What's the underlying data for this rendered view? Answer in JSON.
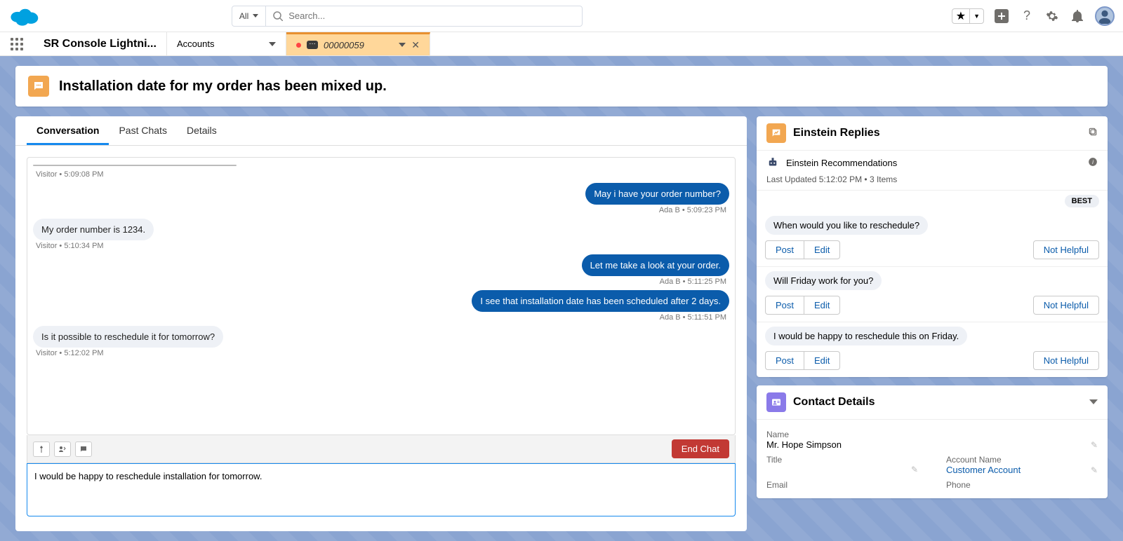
{
  "topbar": {
    "search_scope": "All",
    "search_placeholder": "Search..."
  },
  "nav": {
    "app_name": "SR Console Lightni...",
    "tab_accounts": "Accounts",
    "tab_record_number": "00000059"
  },
  "header": {
    "title": "Installation date for my order has been mixed up."
  },
  "tabs": {
    "conversation": "Conversation",
    "past_chats": "Past Chats",
    "details": "Details"
  },
  "chat": {
    "m0_meta": "Visitor • 5:09:08 PM",
    "m1_text": "May i have your order number?",
    "m1_meta": "Ada B • 5:09:23 PM",
    "m2_text": "My order number is 1234.",
    "m2_meta": "Visitor • 5:10:34 PM",
    "m3_text": "Let me take a look at your order.",
    "m3_meta": "Ada B • 5:11:25 PM",
    "m4_text": "I see that installation date has been scheduled after 2 days.",
    "m4_meta": "Ada B • 5:11:51 PM",
    "m5_text": "Is it possible to reschedule it for tomorrow?",
    "m5_meta": "Visitor • 5:12:02 PM"
  },
  "compose": {
    "end_chat": "End Chat",
    "draft": "I would be happy to reschedule installation for tomorrow."
  },
  "einstein": {
    "title": "Einstein Replies",
    "recs_label": "Einstein Recommendations",
    "meta": "Last Updated 5:12:02 PM • 3 Items",
    "best": "BEST",
    "post": "Post",
    "edit": "Edit",
    "not_helpful": "Not Helpful",
    "r0": "When would you like to reschedule?",
    "r1": "Will Friday work for you?",
    "r2": "I would be happy to reschedule this on Friday."
  },
  "contact": {
    "title": "Contact Details",
    "name_label": "Name",
    "name_value": "Mr. Hope Simpson",
    "title_label": "Title",
    "account_label": "Account Name",
    "account_value": "Customer Account",
    "email_label": "Email",
    "phone_label": "Phone"
  }
}
